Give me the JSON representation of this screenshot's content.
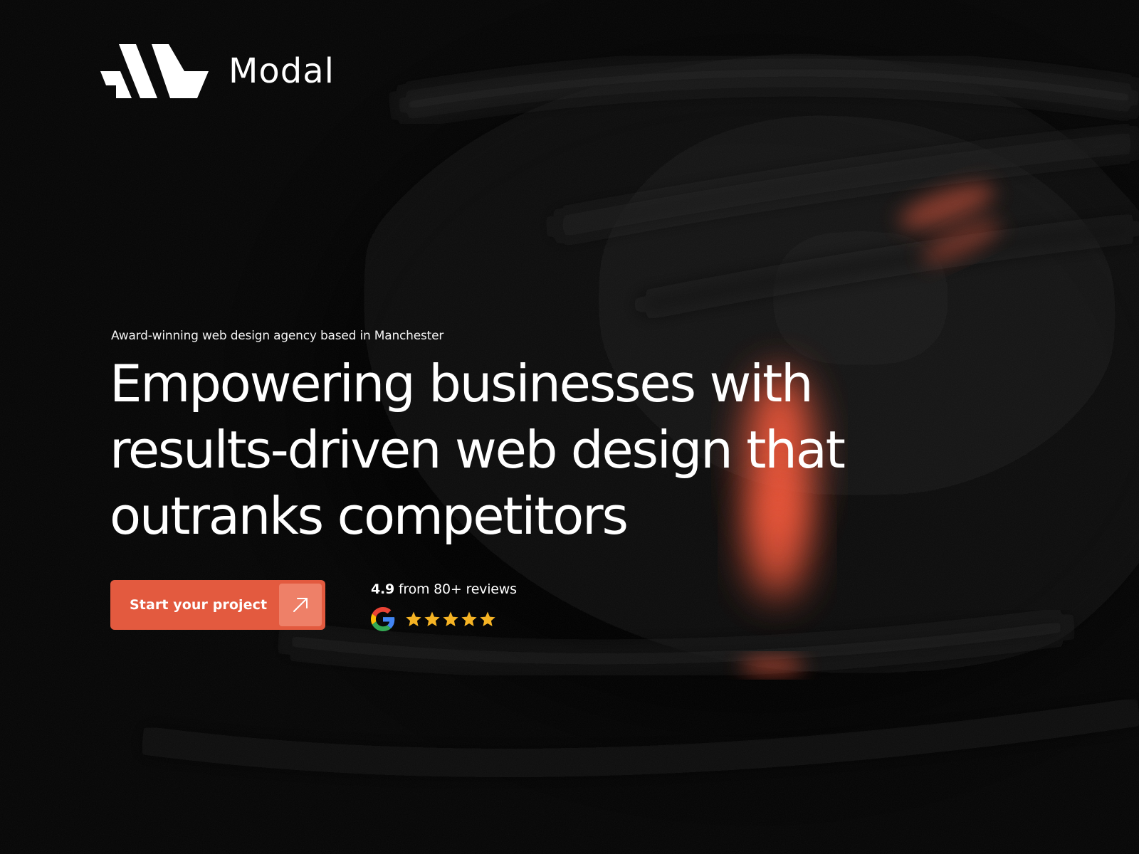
{
  "brand": {
    "name": "Modal",
    "accent_color": "#e35a3f",
    "logo_icon": "modal-logo-mark"
  },
  "hero": {
    "eyebrow": "Award-winning web design agency based in Manchester",
    "headline_lines": [
      "Empowering businesses with",
      "results-driven web design that",
      "outranks competitors"
    ]
  },
  "cta": {
    "label": "Start your project",
    "icon": "arrow-up-right-icon"
  },
  "reviews": {
    "score": "4.9",
    "text": " from 80+ reviews",
    "platform_icon": "google-icon",
    "stars": 5,
    "star_color": "#f5b324"
  }
}
